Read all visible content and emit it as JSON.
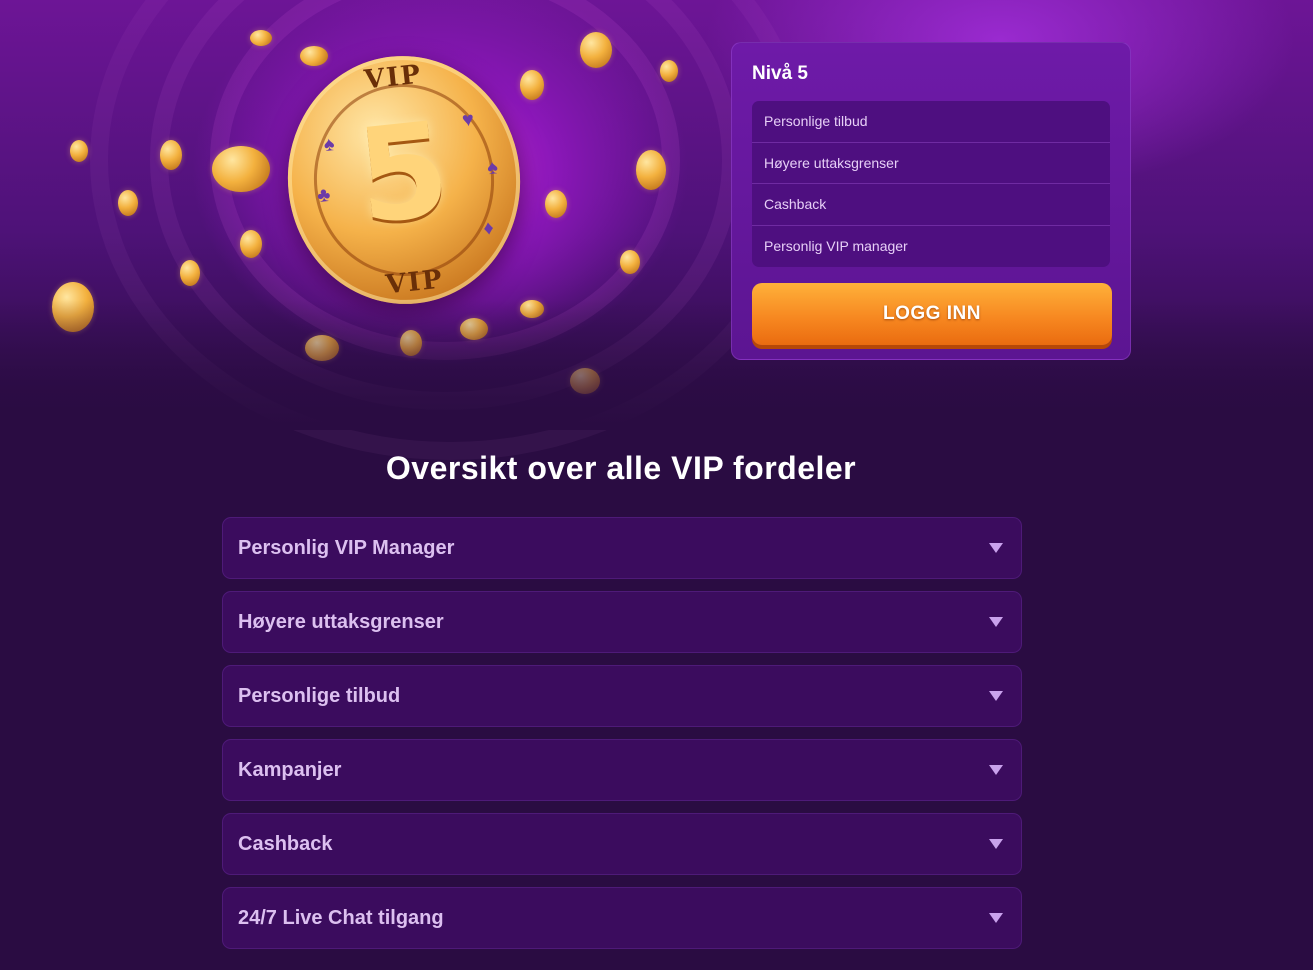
{
  "level_card": {
    "title": "Nivå 5",
    "benefits": [
      "Personlige tilbud",
      "Høyere uttaksgrenser",
      "Cashback",
      "Personlig VIP manager"
    ],
    "login_label": "LOGG INN"
  },
  "hero": {
    "coin_number": "5",
    "coin_text_top": "VIP",
    "coin_text_bottom": "VIP"
  },
  "overview": {
    "title": "Oversikt over alle VIP fordeler",
    "items": [
      "Personlig VIP Manager",
      "Høyere uttaksgrenser",
      "Personlige tilbud",
      "Kampanjer",
      "Cashback",
      "24/7 Live Chat tilgang"
    ]
  },
  "colors": {
    "background": "#2a0c42",
    "card": "#6e1aa8",
    "accent_orange": "#f6851f",
    "accordion_bg": "#3b0c5e"
  }
}
